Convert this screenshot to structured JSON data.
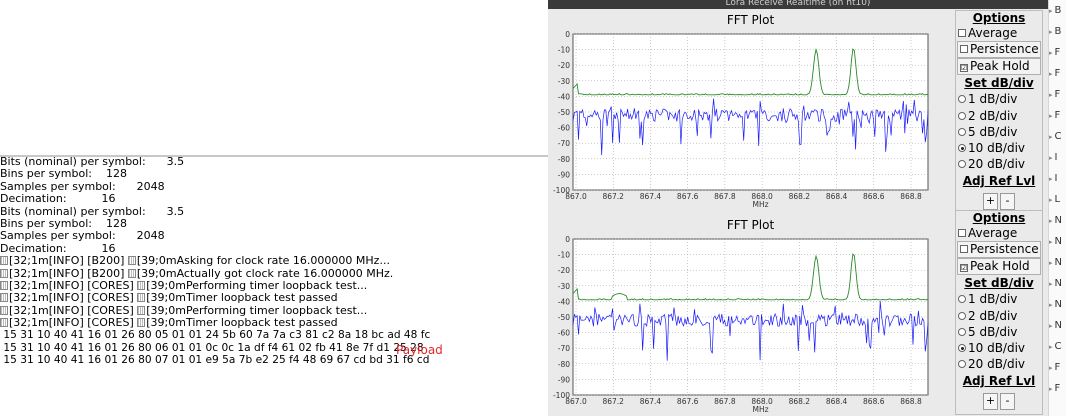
{
  "terminal": {
    "lines": [
      "Bits (nominal) per symbol:      3.5",
      "Bins per symbol:    128",
      "Samples per symbol:      2048",
      "Decimation:          16",
      "Bits (nominal) per symbol:      3.5",
      "Bins per symbol:    128",
      "Samples per symbol:      2048",
      "Decimation:          16"
    ],
    "log_lines": [
      "[32;1m[INFO] [B200] ",
      "[32;1m[INFO] [B200] ",
      "[32;1m[INFO] [CORES] ",
      "[32;1m[INFO] [CORES] ",
      "[32;1m[INFO] [CORES] ",
      "[32;1m[INFO] [CORES] "
    ],
    "log_messages": [
      "[39;0mAsking for clock rate 16.000000 MHz...",
      "[39;0mActually got clock rate 16.000000 MHz.",
      "[39;0mPerforming timer loopback test...",
      "[39;0mTimer loopback test passed",
      "[39;0mPerforming timer loopback test...",
      "[39;0mTimer loopback test passed"
    ],
    "hex_lines": [
      " 15 31 10 40 41 16 01 26 80 05 01 01 24 5b 60 7a 7a c3 81 c2 8a 18 bc ad 48 fc",
      " 15 31 10 40 41 16 01 26 80 06 01 01 0c 0c 1a df f4 61 02 fb 41 8e 7f d1 25 28",
      " 15 31 10 40 41 16 01 26 80 07 01 01 e9 5a 7b e2 25 f4 48 69 67 cd bd 31 f6 cd"
    ],
    "payload_label": "Payload"
  },
  "window": {
    "title": "Lora Receive Realtime (on ht10)"
  },
  "plots": [
    {
      "title": "FFT Plot",
      "xlabel": "MHz",
      "xticks": [
        "867.0",
        "867.2",
        "867.4",
        "867.6",
        "867.8",
        "868.0",
        "868.2",
        "868.4",
        "868.6",
        "868.8"
      ],
      "yticks": [
        "0",
        "-10",
        "-20",
        "-30",
        "-40",
        "-50",
        "-60",
        "-70",
        "-80",
        "-90",
        "-100"
      ]
    },
    {
      "title": "FFT Plot",
      "xlabel": "MHz",
      "xticks": [
        "867.0",
        "867.2",
        "867.4",
        "867.6",
        "867.8",
        "868.0",
        "868.2",
        "868.4",
        "868.6",
        "868.8"
      ],
      "yticks": [
        "0",
        "-10",
        "-20",
        "-30",
        "-40",
        "-50",
        "-60",
        "-70",
        "-80",
        "-90",
        "-100"
      ]
    }
  ],
  "options": [
    {
      "title": "Options",
      "checkboxes": [
        {
          "label": "Average",
          "checked": false
        },
        {
          "label": "Persistence",
          "checked": false
        },
        {
          "label": "Peak Hold",
          "checked": true
        }
      ],
      "set_db_div": "Set dB/div",
      "radios": [
        {
          "label": "1 dB/div",
          "checked": false
        },
        {
          "label": "2 dB/div",
          "checked": false
        },
        {
          "label": "5 dB/div",
          "checked": false
        },
        {
          "label": "10 dB/div",
          "checked": true
        },
        {
          "label": "20 dB/div",
          "checked": false
        }
      ],
      "adj_ref_lvl": "Adj Ref Lvl",
      "plus": "+",
      "minus": "-"
    },
    {
      "title": "Options",
      "checkboxes": [
        {
          "label": "Average",
          "checked": false
        },
        {
          "label": "Persistence",
          "checked": false
        },
        {
          "label": "Peak Hold",
          "checked": true
        }
      ],
      "set_db_div": "Set dB/div",
      "radios": [
        {
          "label": "1 dB/div",
          "checked": false
        },
        {
          "label": "2 dB/div",
          "checked": false
        },
        {
          "label": "5 dB/div",
          "checked": false
        },
        {
          "label": "10 dB/div",
          "checked": true
        },
        {
          "label": "20 dB/div",
          "checked": false
        }
      ],
      "adj_ref_lvl": "Adj Ref Lvl",
      "plus": "+",
      "minus": "-"
    }
  ],
  "right_sidebar": {
    "items": [
      "B",
      "B",
      "F",
      "F",
      "F",
      "F",
      "C",
      "I",
      "I",
      "L",
      "N",
      "N",
      "N",
      "N",
      "N",
      "N",
      "C",
      "F",
      "F"
    ]
  },
  "colors": {
    "spectrum": "#1a1aff",
    "peak_hold": "#2a8a2a",
    "payload": "#e8262a"
  }
}
